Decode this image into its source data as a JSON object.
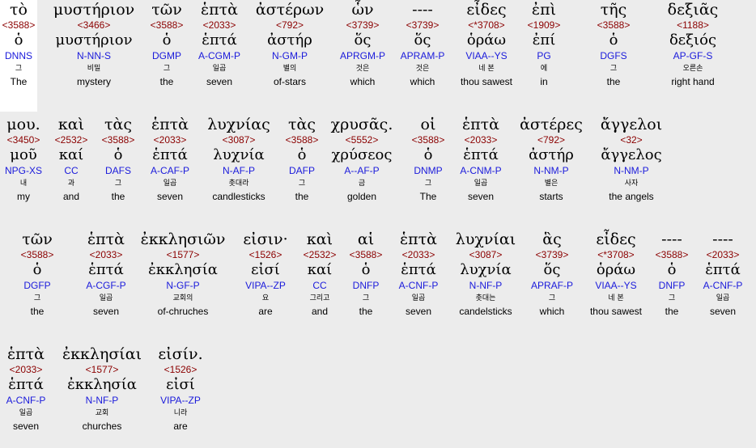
{
  "rows": [
    {
      "words": [
        {
          "greek": "τὸ",
          "strong": "<3588>",
          "lemma": "ὁ",
          "morph": "DNNS",
          "korean": "그",
          "english": "The"
        },
        {
          "greek": "μυστήριον",
          "strong": "<3466>",
          "lemma": "μυστήριον",
          "morph": "N-NN-S",
          "korean": "비밀",
          "english": "mystery"
        },
        {
          "greek": "τῶν",
          "strong": "<3588>",
          "lemma": "ὁ",
          "morph": "DGMP",
          "korean": "그",
          "english": "the"
        },
        {
          "greek": "ἑπτὰ",
          "strong": "<2033>",
          "lemma": "ἑπτά",
          "morph": "A-CGM-P",
          "korean": "일곱",
          "english": "seven"
        },
        {
          "greek": "ἀστέρων",
          "strong": "<792>",
          "lemma": "ἀστήρ",
          "morph": "N-GM-P",
          "korean": "별의",
          "english": "of-stars"
        },
        {
          "greek": "ὧν",
          "strong": "<3739>",
          "lemma": "ὅς",
          "morph": "APRGM-P",
          "korean": "것은",
          "english": "which"
        },
        {
          "greek": "----",
          "strong": "<3739>",
          "lemma": "ὅς",
          "morph": "APRAM-P",
          "korean": "것은",
          "english": "which"
        },
        {
          "greek": "εἶδες",
          "strong": "<*3708>",
          "lemma": "ὁράω",
          "morph": "VIAA--YS",
          "korean": "네 본",
          "english": "thou sawest"
        },
        {
          "greek": "ἐπὶ",
          "strong": "<1909>",
          "lemma": "ἐπί",
          "morph": "PG",
          "korean": "에",
          "english": "in"
        },
        {
          "greek": "τῆς",
          "strong": "<3588>",
          "lemma": "ὁ",
          "morph": "DGFS",
          "korean": "그",
          "english": "the"
        },
        {
          "greek": "δεξιᾶς",
          "strong": "<1188>",
          "lemma": "δεξιός",
          "morph": "AP-GF-S",
          "korean": "오른손",
          "english": "right hand"
        }
      ]
    },
    {
      "words": [
        {
          "greek": "μου.",
          "strong": "<3450>",
          "lemma": "μοῦ",
          "morph": "NPG-XS",
          "korean": "내",
          "english": "my"
        },
        {
          "greek": "καὶ",
          "strong": "<2532>",
          "lemma": "καί",
          "morph": "CC",
          "korean": "과",
          "english": "and"
        },
        {
          "greek": "τὰς",
          "strong": "<3588>",
          "lemma": "ὁ",
          "morph": "DAFS",
          "korean": "그",
          "english": "the"
        },
        {
          "greek": "ἑπτὰ",
          "strong": "<2033>",
          "lemma": "ἑπτά",
          "morph": "A-CAF-P",
          "korean": "일곱",
          "english": "seven"
        },
        {
          "greek": "λυχνίας",
          "strong": "<3087>",
          "lemma": "λυχνία",
          "morph": "N-AF-P",
          "korean": "촛대라",
          "english": "candlesticks"
        },
        {
          "greek": "τὰς",
          "strong": "<3588>",
          "lemma": "ὁ",
          "morph": "DAFP",
          "korean": "그",
          "english": "the"
        },
        {
          "greek": "χρυσᾶς.",
          "strong": "<5552>",
          "lemma": "χρύσεος",
          "morph": "A--AF-P",
          "korean": "금",
          "english": "golden"
        },
        {
          "greek": "οἱ",
          "strong": "<3588>",
          "lemma": "ὁ",
          "morph": "DNMP",
          "korean": "그",
          "english": "The"
        },
        {
          "greek": "ἑπτὰ",
          "strong": "<2033>",
          "lemma": "ἑπτά",
          "morph": "A-CNM-P",
          "korean": "일곱",
          "english": "seven"
        },
        {
          "greek": "ἀστέρες",
          "strong": "<792>",
          "lemma": "ἀστήρ",
          "morph": "N-NM-P",
          "korean": "별은",
          "english": "starts"
        },
        {
          "greek": "ἄγγελοι",
          "strong": "<32>",
          "lemma": "ἄγγελος",
          "morph": "N-NM-P",
          "korean": "사자",
          "english": "the angels"
        }
      ]
    },
    {
      "words": [
        {
          "greek": "τῶν",
          "strong": "<3588>",
          "lemma": "ὁ",
          "morph": "DGFP",
          "korean": "그",
          "english": "the"
        },
        {
          "greek": "ἑπτὰ",
          "strong": "<2033>",
          "lemma": "ἑπτά",
          "morph": "A-CGF-P",
          "korean": "일곱",
          "english": "seven"
        },
        {
          "greek": "ἐκκλησιῶν",
          "strong": "<1577>",
          "lemma": "ἐκκλησία",
          "morph": "N-GF-P",
          "korean": "교회의",
          "english": "of-chruches"
        },
        {
          "greek": "εἰσιν·",
          "strong": "<1526>",
          "lemma": "εἰσί",
          "morph": "VIPA--ZP",
          "korean": "요",
          "english": "are"
        },
        {
          "greek": "καὶ",
          "strong": "<2532>",
          "lemma": "καί",
          "morph": "CC",
          "korean": "그리고",
          "english": "and"
        },
        {
          "greek": "αἱ",
          "strong": "<3588>",
          "lemma": "ὁ",
          "morph": "DNFP",
          "korean": "그",
          "english": "the"
        },
        {
          "greek": "ἑπτὰ",
          "strong": "<2033>",
          "lemma": "ἑπτά",
          "morph": "A-CNF-P",
          "korean": "일곱",
          "english": "seven"
        },
        {
          "greek": "λυχνίαι",
          "strong": "<3087>",
          "lemma": "λυχνία",
          "morph": "N-NF-P",
          "korean": "촛대는",
          "english": "candelsticks"
        },
        {
          "greek": "ἃς",
          "strong": "<3739>",
          "lemma": "ὅς",
          "morph": "APRAF-P",
          "korean": "그",
          "english": "which"
        },
        {
          "greek": "εἶδες",
          "strong": "<*3708>",
          "lemma": "ὁράω",
          "morph": "VIAA--YS",
          "korean": "네 본",
          "english": "thou sawest"
        },
        {
          "greek": "----",
          "strong": "<3588>",
          "lemma": "ὁ",
          "morph": "DNFP",
          "korean": "그",
          "english": "the"
        },
        {
          "greek": "----",
          "strong": "<2033>",
          "lemma": "ἑπτά",
          "morph": "A-CNF-P",
          "korean": "일곱",
          "english": "seven"
        }
      ]
    },
    {
      "words": [
        {
          "greek": "ἑπτὰ",
          "strong": "<2033>",
          "lemma": "ἑπτά",
          "morph": "A-CNF-P",
          "korean": "일곱",
          "english": "seven"
        },
        {
          "greek": "ἐκκλησίαι",
          "strong": "<1577>",
          "lemma": "ἐκκλησία",
          "morph": "N-NF-P",
          "korean": "교회",
          "english": "churches"
        },
        {
          "greek": "εἰσίν.",
          "strong": "<1526>",
          "lemma": "εἰσί",
          "morph": "VIPA--ZP",
          "korean": "니라",
          "english": "are"
        }
      ]
    }
  ]
}
